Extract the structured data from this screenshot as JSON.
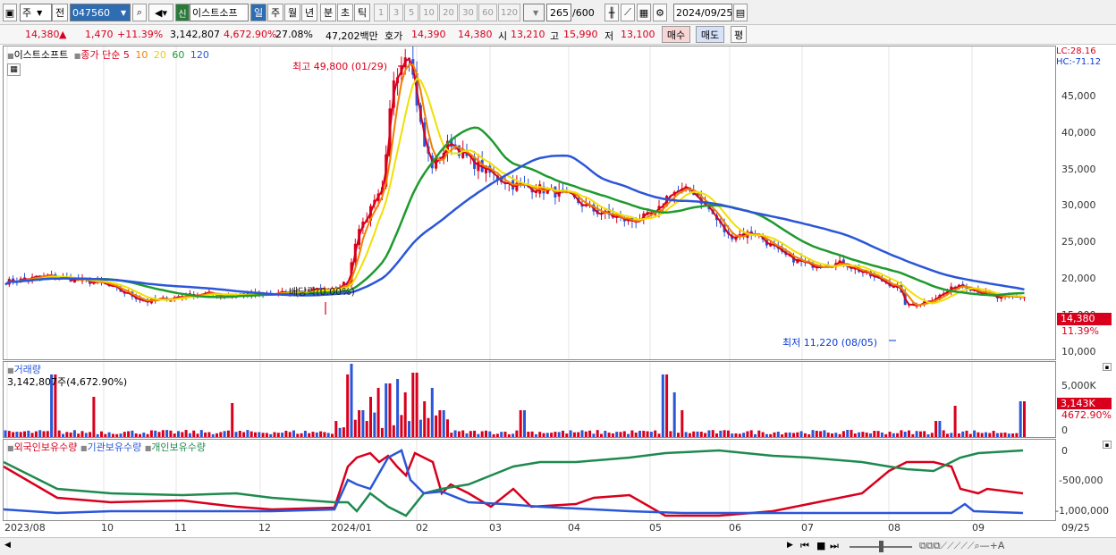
{
  "toolbar": {
    "market": "주",
    "prev_label": "전",
    "code": "047560",
    "stock_name": "이스트소프",
    "new_badge": "신",
    "periods": [
      "일",
      "주",
      "월",
      "년",
      "분",
      "초",
      "틱"
    ],
    "nums": [
      "1",
      "3",
      "5",
      "10",
      "20",
      "30",
      "60",
      "120"
    ],
    "count": "265",
    "count_total": "/600",
    "date": "2024/09/25"
  },
  "info": {
    "price": "14,380",
    "arrow": "▲",
    "change": "1,470",
    "change_pct": "+11.39%",
    "volume": "3,142,807",
    "vol_ratio": "4,672.90%",
    "turnover": "27.08%",
    "amount": "47,202백만",
    "quote_label": "호가",
    "ask": "14,390",
    "bid": "14,380",
    "open_label": "시",
    "open": "13,210",
    "high_label": "고",
    "high": "15,990",
    "low_label": "저",
    "low": "13,100",
    "buy": "매수",
    "sell": "매도",
    "eval": "평"
  },
  "price_chart": {
    "legend_name": "이스트소프트",
    "legend_ma_label": "종가 단순",
    "ma_periods": [
      "5",
      "10",
      "20",
      "60",
      "120"
    ],
    "ma_colors": [
      "#d8001c",
      "#f08000",
      "#f0e000",
      "#1e9a2e",
      "#2a56d8"
    ],
    "yticks": [
      "45,000",
      "40,000",
      "35,000",
      "30,000",
      "25,000",
      "20,000",
      "15,000",
      "10,000"
    ],
    "lc": "LC:28.16",
    "hc": "HC:-71.12",
    "cur_price": "14,380",
    "cur_pct": "11.39%",
    "high_note": "최고 49,800 (01/29)",
    "low_note": "최저 11,220 (08/05)",
    "div_note": "배당락(0.00%)",
    "up_color": "#d8001c",
    "down_color": "#2a56d8"
  },
  "volume_chart": {
    "title": "거래량",
    "value": "3,142,807주(4,672.90%)",
    "yticks": [
      "5,000K",
      "0"
    ],
    "cur": "3,143K",
    "cur_pct": "4672.90%"
  },
  "holding_chart": {
    "legend": [
      "외국인보유수량",
      "기관보유수량",
      "개인보유수량"
    ],
    "colors": [
      "#d8001c",
      "#2a56d8",
      "#1e8a4e"
    ],
    "yticks": [
      "0",
      "-500,000",
      "-1,000,000"
    ]
  },
  "xaxis": [
    "2023/08",
    "10",
    "11",
    "12",
    "2024/01",
    "02",
    "03",
    "04",
    "05",
    "06",
    "07",
    "08",
    "09",
    "09/25"
  ]
}
